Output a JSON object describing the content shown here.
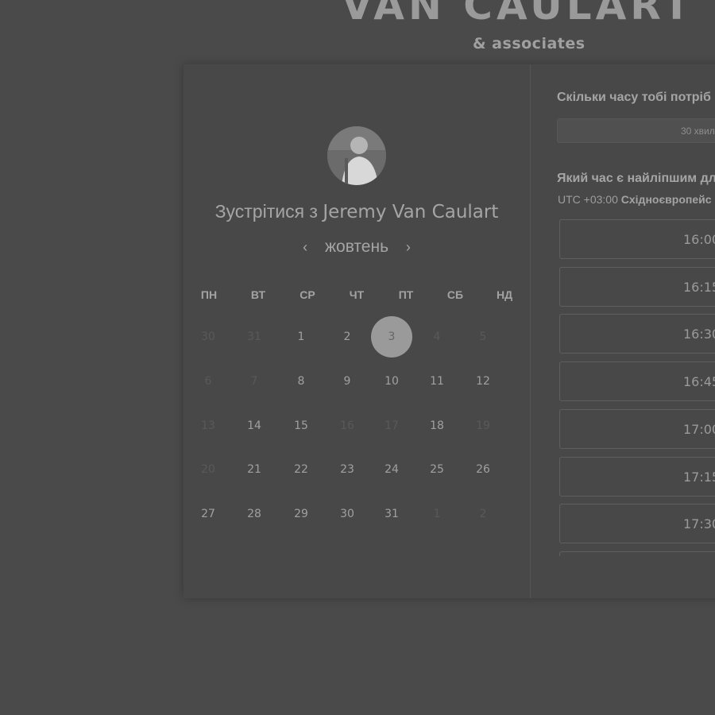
{
  "brand": {
    "title": "VAN CAULART",
    "subtitle": "& associates"
  },
  "booking": {
    "headline_prefix": "Зустрітися з",
    "host_name": "Jeremy Van Caulart",
    "month": "жовтень",
    "prev_icon": "chevron-left-icon",
    "next_icon": "chevron-right-icon",
    "weekdays": [
      "ПН",
      "ВТ",
      "СР",
      "ЧТ",
      "ПТ",
      "СБ",
      "НД"
    ],
    "weeks": [
      [
        {
          "d": "30",
          "s": "muted"
        },
        {
          "d": "31",
          "s": "muted"
        },
        {
          "d": "1",
          "s": "active"
        },
        {
          "d": "2",
          "s": "active"
        },
        {
          "d": "3",
          "s": "selected"
        },
        {
          "d": "4",
          "s": "muted"
        },
        {
          "d": "5",
          "s": "muted"
        }
      ],
      [
        {
          "d": "6",
          "s": "muted"
        },
        {
          "d": "7",
          "s": "muted"
        },
        {
          "d": "8",
          "s": "active"
        },
        {
          "d": "9",
          "s": "active"
        },
        {
          "d": "10",
          "s": "active"
        },
        {
          "d": "11",
          "s": "active"
        },
        {
          "d": "12",
          "s": "active"
        }
      ],
      [
        {
          "d": "13",
          "s": "muted"
        },
        {
          "d": "14",
          "s": "active"
        },
        {
          "d": "15",
          "s": "active"
        },
        {
          "d": "16",
          "s": "muted"
        },
        {
          "d": "17",
          "s": "muted"
        },
        {
          "d": "18",
          "s": "active"
        },
        {
          "d": "19",
          "s": "muted"
        }
      ],
      [
        {
          "d": "20",
          "s": "muted"
        },
        {
          "d": "21",
          "s": "active"
        },
        {
          "d": "22",
          "s": "active"
        },
        {
          "d": "23",
          "s": "active"
        },
        {
          "d": "24",
          "s": "active"
        },
        {
          "d": "25",
          "s": "active"
        },
        {
          "d": "26",
          "s": "active"
        }
      ],
      [
        {
          "d": "27",
          "s": "active"
        },
        {
          "d": "28",
          "s": "active"
        },
        {
          "d": "29",
          "s": "active"
        },
        {
          "d": "30",
          "s": "active"
        },
        {
          "d": "31",
          "s": "active"
        },
        {
          "d": "1",
          "s": "muted"
        },
        {
          "d": "2",
          "s": "muted"
        }
      ]
    ]
  },
  "scheduler": {
    "duration_question": "Скільки часу тобі потріб",
    "duration_value": "30 хвил",
    "time_question": "Який час є найліпшим дл",
    "timezone_offset": "UTC +03:00",
    "timezone_name": "Східноєвропейс",
    "slots": [
      "16:00",
      "16:15",
      "16:30",
      "16:45",
      "17:00",
      "17:15",
      "17:30",
      ""
    ]
  },
  "colors": {
    "background": "#4a4a4a",
    "panel": "#484848",
    "selected_day": "#9a9a9a"
  }
}
